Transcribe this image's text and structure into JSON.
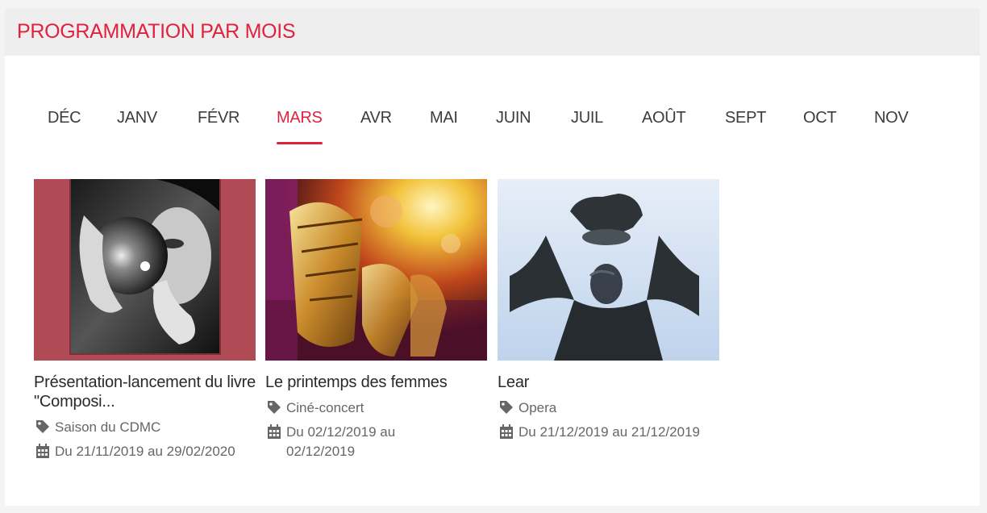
{
  "header": {
    "title": "PROGRAMMATION PAR MOIS"
  },
  "months": [
    {
      "label": "DÉC",
      "active": false
    },
    {
      "label": "JANV",
      "active": false
    },
    {
      "label": "FÉVR",
      "active": false
    },
    {
      "label": "MARS",
      "active": true
    },
    {
      "label": "AVR",
      "active": false
    },
    {
      "label": "MAI",
      "active": false
    },
    {
      "label": "JUIN",
      "active": false
    },
    {
      "label": "JUIL",
      "active": false
    },
    {
      "label": "AOÛT",
      "active": false
    },
    {
      "label": "SEPT",
      "active": false
    },
    {
      "label": "OCT",
      "active": false
    },
    {
      "label": "NOV",
      "active": false
    }
  ],
  "events": [
    {
      "title": "Présentation-lancement du livre \"Composi...",
      "category": "Saison du CDMC",
      "dates": "Du 21/11/2019 au 29/02/2020",
      "image": "portrait-with-reflective-sphere"
    },
    {
      "title": "Le printemps des femmes",
      "category": "Ciné-concert",
      "dates": "Du 02/12/2019 au 02/12/2019",
      "image": "saxophone-players"
    },
    {
      "title": "Lear",
      "category": "Opera",
      "dates": "Du 21/12/2019 au 21/12/2019",
      "image": "statue-holding-crown"
    }
  ],
  "icons": {
    "category": "tag-icon",
    "date": "calendar-icon"
  },
  "colors": {
    "accent": "#e0223f",
    "header_bg": "#eeeeee"
  }
}
